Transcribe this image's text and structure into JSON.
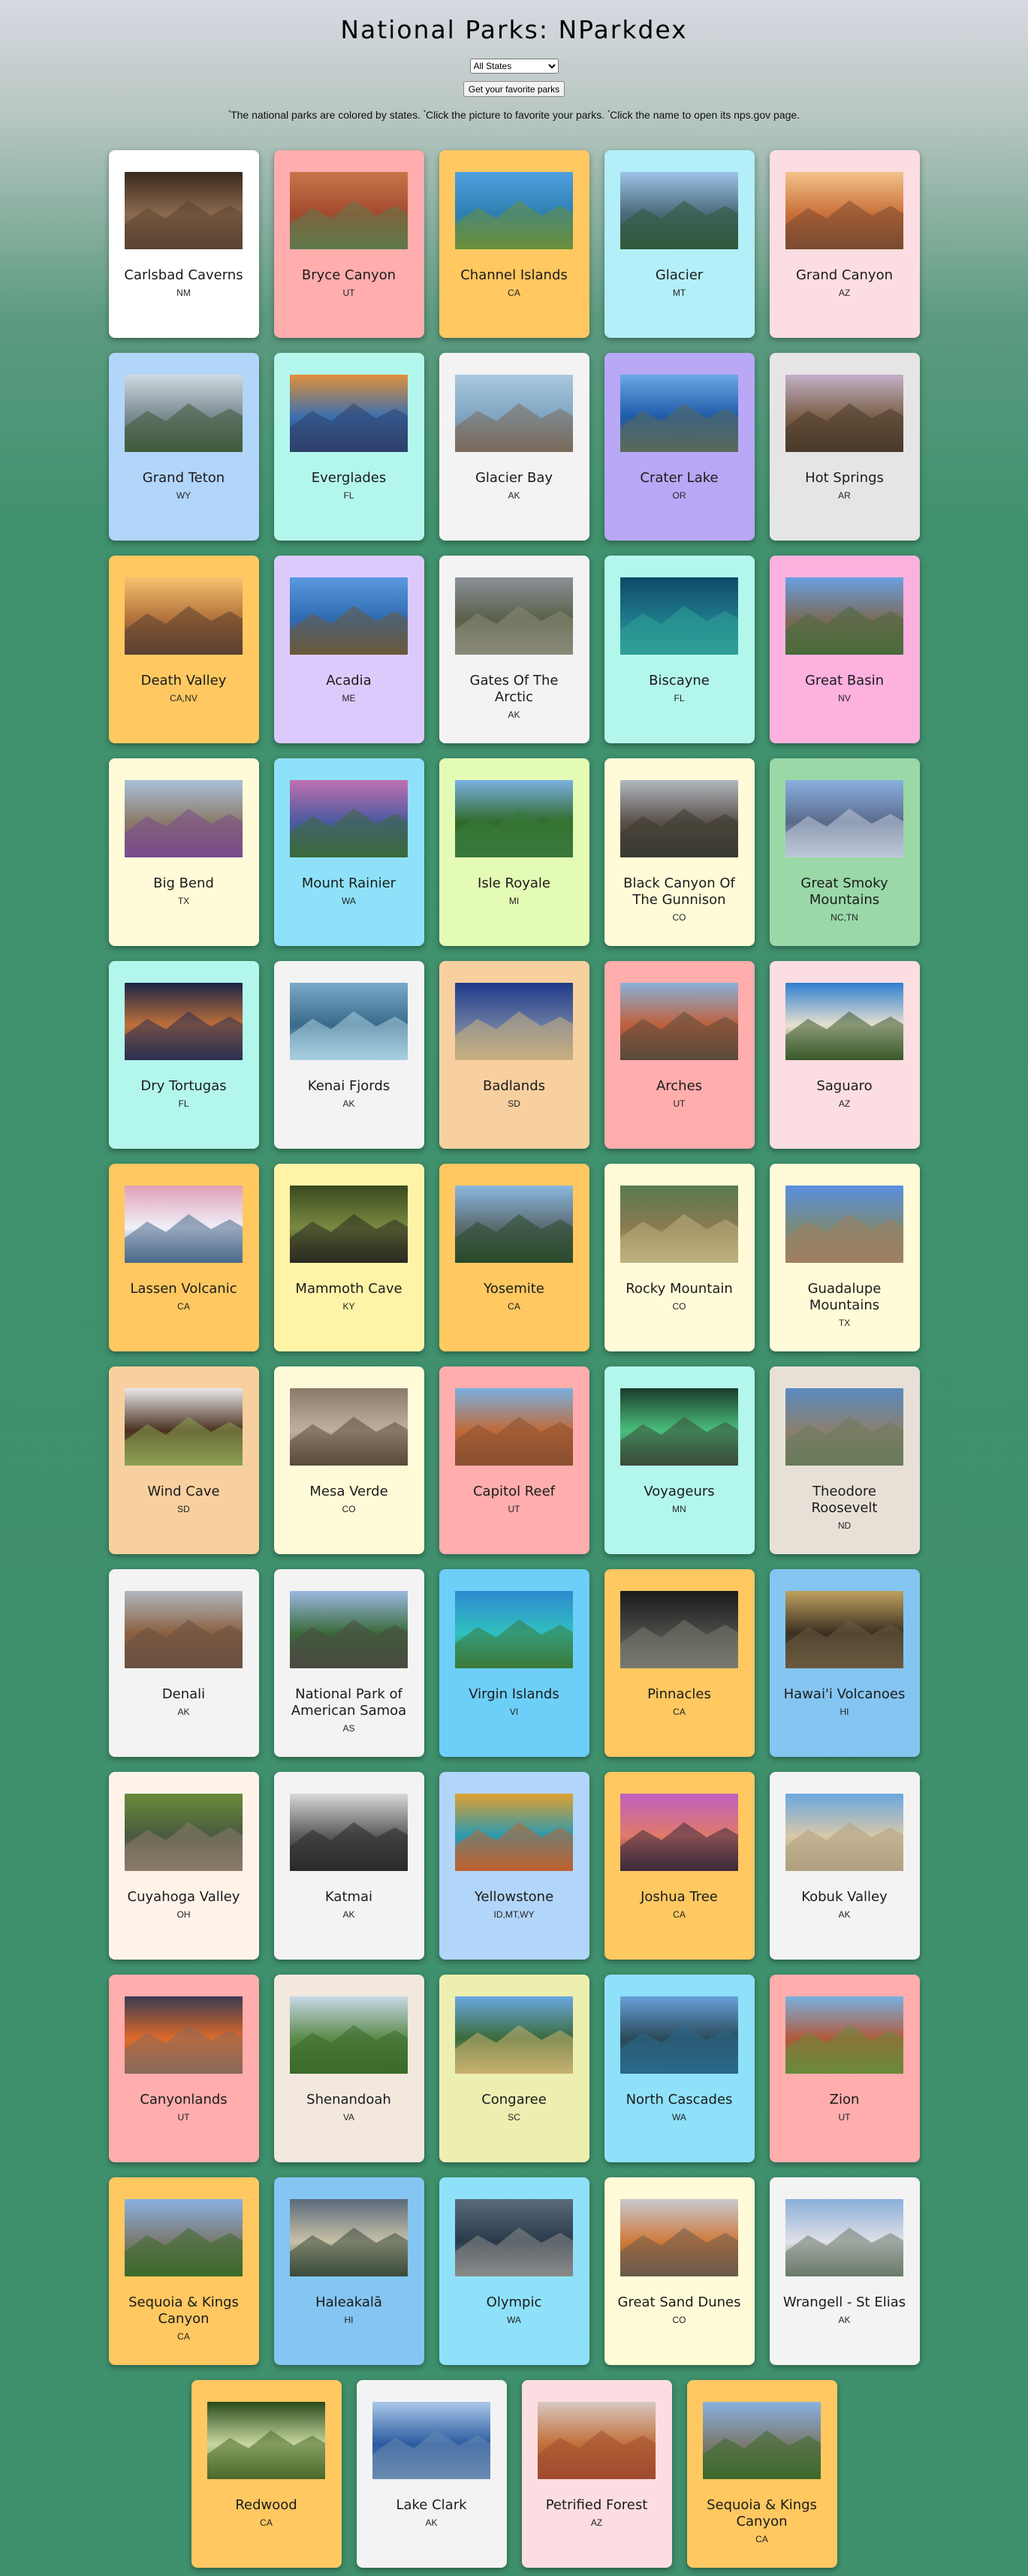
{
  "page": {
    "title": "National Parks: NParkdex",
    "state_select": {
      "selected": "All States"
    },
    "favorites_button": "Get your favorite parks",
    "instructions": {
      "part1": "The national parks are colored by states. ",
      "part2": "Click the picture to favorite your parks. ",
      "part3": "Click the name to open its nps.gov page.",
      "marker": "*"
    }
  },
  "parks": [
    {
      "name": "Carlsbad Caverns",
      "state": "NM",
      "color": "#ffffff",
      "photo": [
        "#3b2a1f",
        "#8b6a4e",
        "#5b4332"
      ]
    },
    {
      "name": "Bryce Canyon",
      "state": "UT",
      "color": "#ffadad",
      "photo": [
        "#c8754a",
        "#a34a2e",
        "#5e7a4a"
      ]
    },
    {
      "name": "Channel Islands",
      "state": "CA",
      "color": "#ffc861",
      "photo": [
        "#4f9fe0",
        "#2e7fb0",
        "#6a8f3a"
      ]
    },
    {
      "name": "Glacier",
      "state": "MT",
      "color": "#b3eff8",
      "photo": [
        "#9ec3e6",
        "#4a6a7a",
        "#2f5a3a"
      ]
    },
    {
      "name": "Grand Canyon",
      "state": "AZ",
      "color": "#fcdde1",
      "photo": [
        "#f4c28a",
        "#c9703a",
        "#7a4a30"
      ]
    },
    {
      "name": "Grand Teton",
      "state": "WY",
      "color": "#b2d5fa",
      "photo": [
        "#cfd8e0",
        "#7a8a90",
        "#3f5a3a"
      ]
    },
    {
      "name": "Everglades",
      "state": "FL",
      "color": "#b3f7ec",
      "photo": [
        "#e0903a",
        "#3a6fb0",
        "#2e3f6a"
      ]
    },
    {
      "name": "Glacier Bay",
      "state": "AK",
      "color": "#f3f3f3",
      "photo": [
        "#aac8e0",
        "#7fa5c0",
        "#7a6a5a"
      ]
    },
    {
      "name": "Crater Lake",
      "state": "OR",
      "color": "#b8a8f5",
      "photo": [
        "#6aa8e6",
        "#1f5aa8",
        "#5a6a5a"
      ]
    },
    {
      "name": "Hot Springs",
      "state": "AR",
      "color": "#e5e5e5",
      "photo": [
        "#c3b0c8",
        "#7a6048",
        "#4a3a2a"
      ]
    },
    {
      "name": "Death Valley",
      "state": "CA,NV",
      "color": "#ffc861",
      "photo": [
        "#f6c270",
        "#b0703a",
        "#5a4030"
      ]
    },
    {
      "name": "Acadia",
      "state": "ME",
      "color": "#ddcafc",
      "photo": [
        "#5a9ae0",
        "#2f6ab0",
        "#6a5a3a"
      ]
    },
    {
      "name": "Gates Of The Arctic",
      "state": "AK",
      "color": "#f3f3f3",
      "photo": [
        "#8a9098",
        "#5a6048",
        "#8a8a78"
      ]
    },
    {
      "name": "Biscayne",
      "state": "FL",
      "color": "#b3f7ec",
      "photo": [
        "#0f4a6a",
        "#1f7a8a",
        "#2fa098"
      ]
    },
    {
      "name": "Great Basin",
      "state": "NV",
      "color": "#fcb1df",
      "photo": [
        "#6aa0e0",
        "#7a6a5a",
        "#4a6a3a"
      ]
    },
    {
      "name": "Big Bend",
      "state": "TX",
      "color": "#fffbd8",
      "photo": [
        "#aac0d8",
        "#8a7a6a",
        "#7a4a8a"
      ]
    },
    {
      "name": "Mount Rainier",
      "state": "WA",
      "color": "#8ee1f9",
      "photo": [
        "#c070b0",
        "#4a5aa0",
        "#3a6a3a"
      ]
    },
    {
      "name": "Isle Royale",
      "state": "MI",
      "color": "#e4fbb5",
      "photo": [
        "#7ab0e0",
        "#2f6a2a",
        "#3a7a3a"
      ]
    },
    {
      "name": "Black Canyon Of The Gunnison",
      "state": "CO",
      "color": "#fffbd8",
      "photo": [
        "#b0b8c0",
        "#5a5048",
        "#3a3a30"
      ]
    },
    {
      "name": "Great Smoky Mountains",
      "state": "NC,TN",
      "color": "#9ad8a7",
      "photo": [
        "#8ab0e0",
        "#5a6a8a",
        "#c0c8d8"
      ]
    },
    {
      "name": "Dry Tortugas",
      "state": "FL",
      "color": "#b3f7ec",
      "photo": [
        "#1a2448",
        "#c0703a",
        "#2a3050"
      ]
    },
    {
      "name": "Kenai Fjords",
      "state": "AK",
      "color": "#f3f3f3",
      "photo": [
        "#7aa8c8",
        "#3a6a8a",
        "#a8d0e0"
      ]
    },
    {
      "name": "Badlands",
      "state": "SD",
      "color": "#f8d0a0",
      "photo": [
        "#1f3a8a",
        "#6a7aa0",
        "#c8b080"
      ]
    },
    {
      "name": "Arches",
      "state": "UT",
      "color": "#ffadad",
      "photo": [
        "#8ab0d8",
        "#c0603a",
        "#5a4a3a"
      ]
    },
    {
      "name": "Saguaro",
      "state": "AZ",
      "color": "#fcdde1",
      "photo": [
        "#2f7fd0",
        "#e8e0d0",
        "#3a5a2a"
      ]
    },
    {
      "name": "Lassen Volcanic",
      "state": "CA",
      "color": "#ffc861",
      "photo": [
        "#e0a0b8",
        "#f0f0f8",
        "#4a6a8a"
      ]
    },
    {
      "name": "Mammoth Cave",
      "state": "KY",
      "color": "#fff3a8",
      "photo": [
        "#3a4a20",
        "#7a8a40",
        "#2a2a20"
      ]
    },
    {
      "name": "Yosemite",
      "state": "CA",
      "color": "#ffc861",
      "photo": [
        "#8ab8e0",
        "#5a6a70",
        "#2a4a2a"
      ]
    },
    {
      "name": "Rocky Mountain",
      "state": "CO",
      "color": "#fffbd8",
      "photo": [
        "#5a7a50",
        "#8a7a50",
        "#c0b080"
      ]
    },
    {
      "name": "Guadalupe Mountains",
      "state": "TX",
      "color": "#fffbd8",
      "photo": [
        "#5a90e0",
        "#7a8a7a",
        "#a08060"
      ]
    },
    {
      "name": "Wind Cave",
      "state": "SD",
      "color": "#f8d0a0",
      "photo": [
        "#e8e8e8",
        "#4a3020",
        "#8aa050"
      ]
    },
    {
      "name": "Mesa Verde",
      "state": "CO",
      "color": "#fffbd8",
      "photo": [
        "#8a7a6a",
        "#c0b0a0",
        "#5a4a3a"
      ]
    },
    {
      "name": "Capitol Reef",
      "state": "UT",
      "color": "#ffadad",
      "photo": [
        "#7ab0e0",
        "#c06a3a",
        "#8a5030"
      ]
    },
    {
      "name": "Voyageurs",
      "state": "MN",
      "color": "#b3f7ec",
      "photo": [
        "#1a3a2a",
        "#4ac07a",
        "#3a4a3a"
      ]
    },
    {
      "name": "Theodore Roosevelt",
      "state": "ND",
      "color": "#e8e0d6",
      "photo": [
        "#5a8ac0",
        "#8a8070",
        "#6a7a5a"
      ]
    },
    {
      "name": "Denali",
      "state": "AK",
      "color": "#f3f3f3",
      "photo": [
        "#b0b8c0",
        "#8a6040",
        "#6a5040"
      ]
    },
    {
      "name": "National Park of American Samoa",
      "state": "AS",
      "color": "#f3f3f3",
      "photo": [
        "#9ab8e0",
        "#3a6a3a",
        "#4a4a40"
      ]
    },
    {
      "name": "Virgin Islands",
      "state": "VI",
      "color": "#6dcff8",
      "photo": [
        "#2f8ad0",
        "#2fc0c0",
        "#3a7a3a"
      ]
    },
    {
      "name": "Pinnacles",
      "state": "CA",
      "color": "#ffc861",
      "photo": [
        "#1a1a1a",
        "#4a4a48",
        "#7a7a70"
      ]
    },
    {
      "name": "Hawai'i Volcanoes",
      "state": "HI",
      "color": "#84c5f2",
      "photo": [
        "#c0a060",
        "#3a3020",
        "#6a5a40"
      ]
    },
    {
      "name": "Cuyahoga Valley",
      "state": "OH",
      "color": "#fff2e8",
      "photo": [
        "#6a8a3a",
        "#4a5a40",
        "#8a7a6a"
      ]
    },
    {
      "name": "Katmai",
      "state": "AK",
      "color": "#f3f3f3",
      "photo": [
        "#d8d8d8",
        "#5a5a5a",
        "#2a2a2a"
      ]
    },
    {
      "name": "Yellowstone",
      "state": "ID,MT,WY",
      "color": "#b2d5fa",
      "photo": [
        "#e0a030",
        "#2a9ab0",
        "#c06030"
      ]
    },
    {
      "name": "Joshua Tree",
      "state": "CA",
      "color": "#ffc861",
      "photo": [
        "#c060c0",
        "#e07a6a",
        "#3a2a3a"
      ]
    },
    {
      "name": "Kobuk Valley",
      "state": "AK",
      "color": "#f3f3f3",
      "photo": [
        "#6aa8e0",
        "#d8c8a8",
        "#b0a080"
      ]
    },
    {
      "name": "Canyonlands",
      "state": "UT",
      "color": "#ffadad",
      "photo": [
        "#3a3a50",
        "#e06a2a",
        "#8a6a5a"
      ]
    },
    {
      "name": "Shenandoah",
      "state": "VA",
      "color": "#f2e8de",
      "photo": [
        "#c8d8e8",
        "#5a8a4a",
        "#3a6a2a"
      ]
    },
    {
      "name": "Congaree",
      "state": "SC",
      "color": "#ecefb0",
      "photo": [
        "#6aa8e0",
        "#3a6a3a",
        "#c8b070"
      ]
    },
    {
      "name": "North Cascades",
      "state": "WA",
      "color": "#8ee1f9",
      "photo": [
        "#6aa0d8",
        "#2a4a5a",
        "#2a6a8a"
      ]
    },
    {
      "name": "Zion",
      "state": "UT",
      "color": "#ffadad",
      "photo": [
        "#7ab0e0",
        "#b05a3a",
        "#6a8a3a"
      ]
    },
    {
      "name": "Sequoia & Kings Canyon",
      "state": "CA",
      "color": "#ffc861",
      "photo": [
        "#8ab0e0",
        "#7a7a70",
        "#3a6a2a"
      ]
    },
    {
      "name": "Haleakalā",
      "state": "HI",
      "color": "#84c5f2",
      "photo": [
        "#5a6a7a",
        "#c8c0a8",
        "#3a4a3a"
      ]
    },
    {
      "name": "Olympic",
      "state": "WA",
      "color": "#8ee1f9",
      "photo": [
        "#5a6a7a",
        "#2a3a4a",
        "#8a8a8a"
      ]
    },
    {
      "name": "Great Sand Dunes",
      "state": "CO",
      "color": "#fffbd8",
      "photo": [
        "#c8c8d0",
        "#d07a3a",
        "#6a5a4a"
      ]
    },
    {
      "name": "Wrangell - St Elias",
      "state": "AK",
      "color": "#f3f3f3",
      "photo": [
        "#8ab0d8",
        "#e0e0e8",
        "#6a7a6a"
      ]
    },
    {
      "name": "Redwood",
      "state": "CA",
      "color": "#ffc861",
      "photo": [
        "#2a4a1a",
        "#c8d8a0",
        "#4a6a2a"
      ]
    },
    {
      "name": "Lake Clark",
      "state": "AK",
      "color": "#f3f3f3",
      "photo": [
        "#aac8e8",
        "#2a5aa0",
        "#6a8ab0"
      ]
    },
    {
      "name": "Petrified Forest",
      "state": "AZ",
      "color": "#fcdde1",
      "photo": [
        "#d8c8c0",
        "#c0703a",
        "#a04a30"
      ]
    },
    {
      "name": "Sequoia & Kings Canyon",
      "state": "CA",
      "color": "#ffc861",
      "photo": [
        "#8ab0e0",
        "#7a7a70",
        "#3a6a2a"
      ]
    }
  ]
}
